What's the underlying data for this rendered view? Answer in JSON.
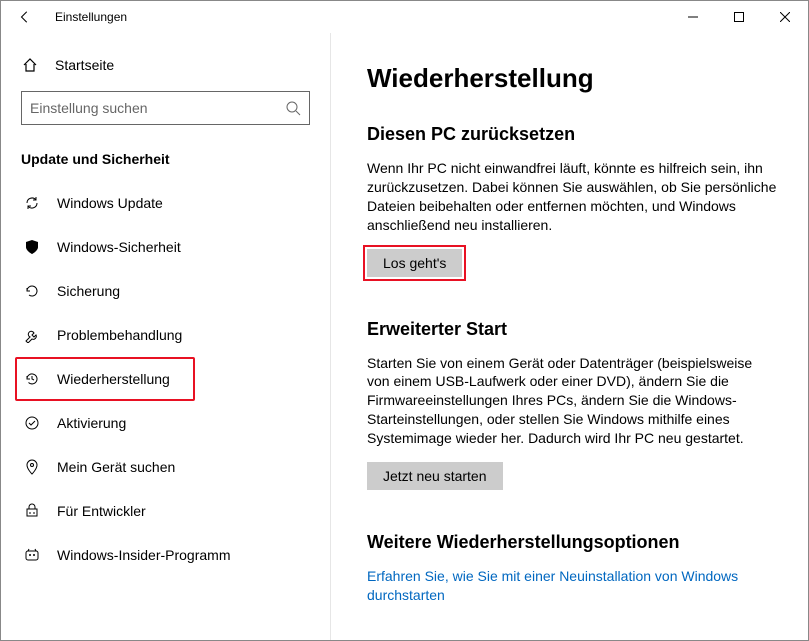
{
  "window": {
    "title": "Einstellungen"
  },
  "sidebar": {
    "home": "Startseite",
    "search_placeholder": "Einstellung suchen",
    "category": "Update und Sicherheit",
    "items": [
      {
        "label": "Windows Update"
      },
      {
        "label": "Windows-Sicherheit"
      },
      {
        "label": "Sicherung"
      },
      {
        "label": "Problembehandlung"
      },
      {
        "label": "Wiederherstellung"
      },
      {
        "label": "Aktivierung"
      },
      {
        "label": "Mein Gerät suchen"
      },
      {
        "label": "Für Entwickler"
      },
      {
        "label": "Windows-Insider-Programm"
      }
    ]
  },
  "main": {
    "heading": "Wiederherstellung",
    "reset": {
      "title": "Diesen PC zurücksetzen",
      "body": "Wenn Ihr PC nicht einwandfrei läuft, könnte es hilfreich sein, ihn zurückzusetzen. Dabei können Sie auswählen, ob Sie persönliche Dateien beibehalten oder entfernen möchten, und Windows anschließend neu installieren.",
      "button": "Los geht's"
    },
    "advanced": {
      "title": "Erweiterter Start",
      "body": "Starten Sie von einem Gerät oder Datenträger (beispielsweise von einem USB-Laufwerk oder einer DVD), ändern Sie die Firmwareeinstellungen Ihres PCs, ändern Sie die Windows-Starteinstellungen, oder stellen Sie Windows mithilfe eines Systemimage wieder her. Dadurch wird Ihr PC neu gestartet.",
      "button": "Jetzt neu starten"
    },
    "more": {
      "title": "Weitere Wiederherstellungsoptionen",
      "link": "Erfahren Sie, wie Sie mit einer Neuinstallation von Windows durchstarten"
    }
  }
}
